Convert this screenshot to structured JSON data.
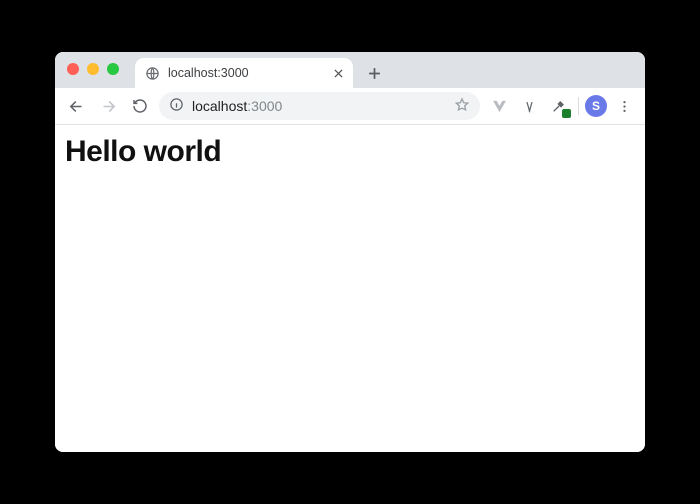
{
  "tab": {
    "title": "localhost:3000"
  },
  "address": {
    "host": "localhost",
    "port": ":3000"
  },
  "profile": {
    "initial": "S"
  },
  "page": {
    "heading": "Hello world"
  }
}
